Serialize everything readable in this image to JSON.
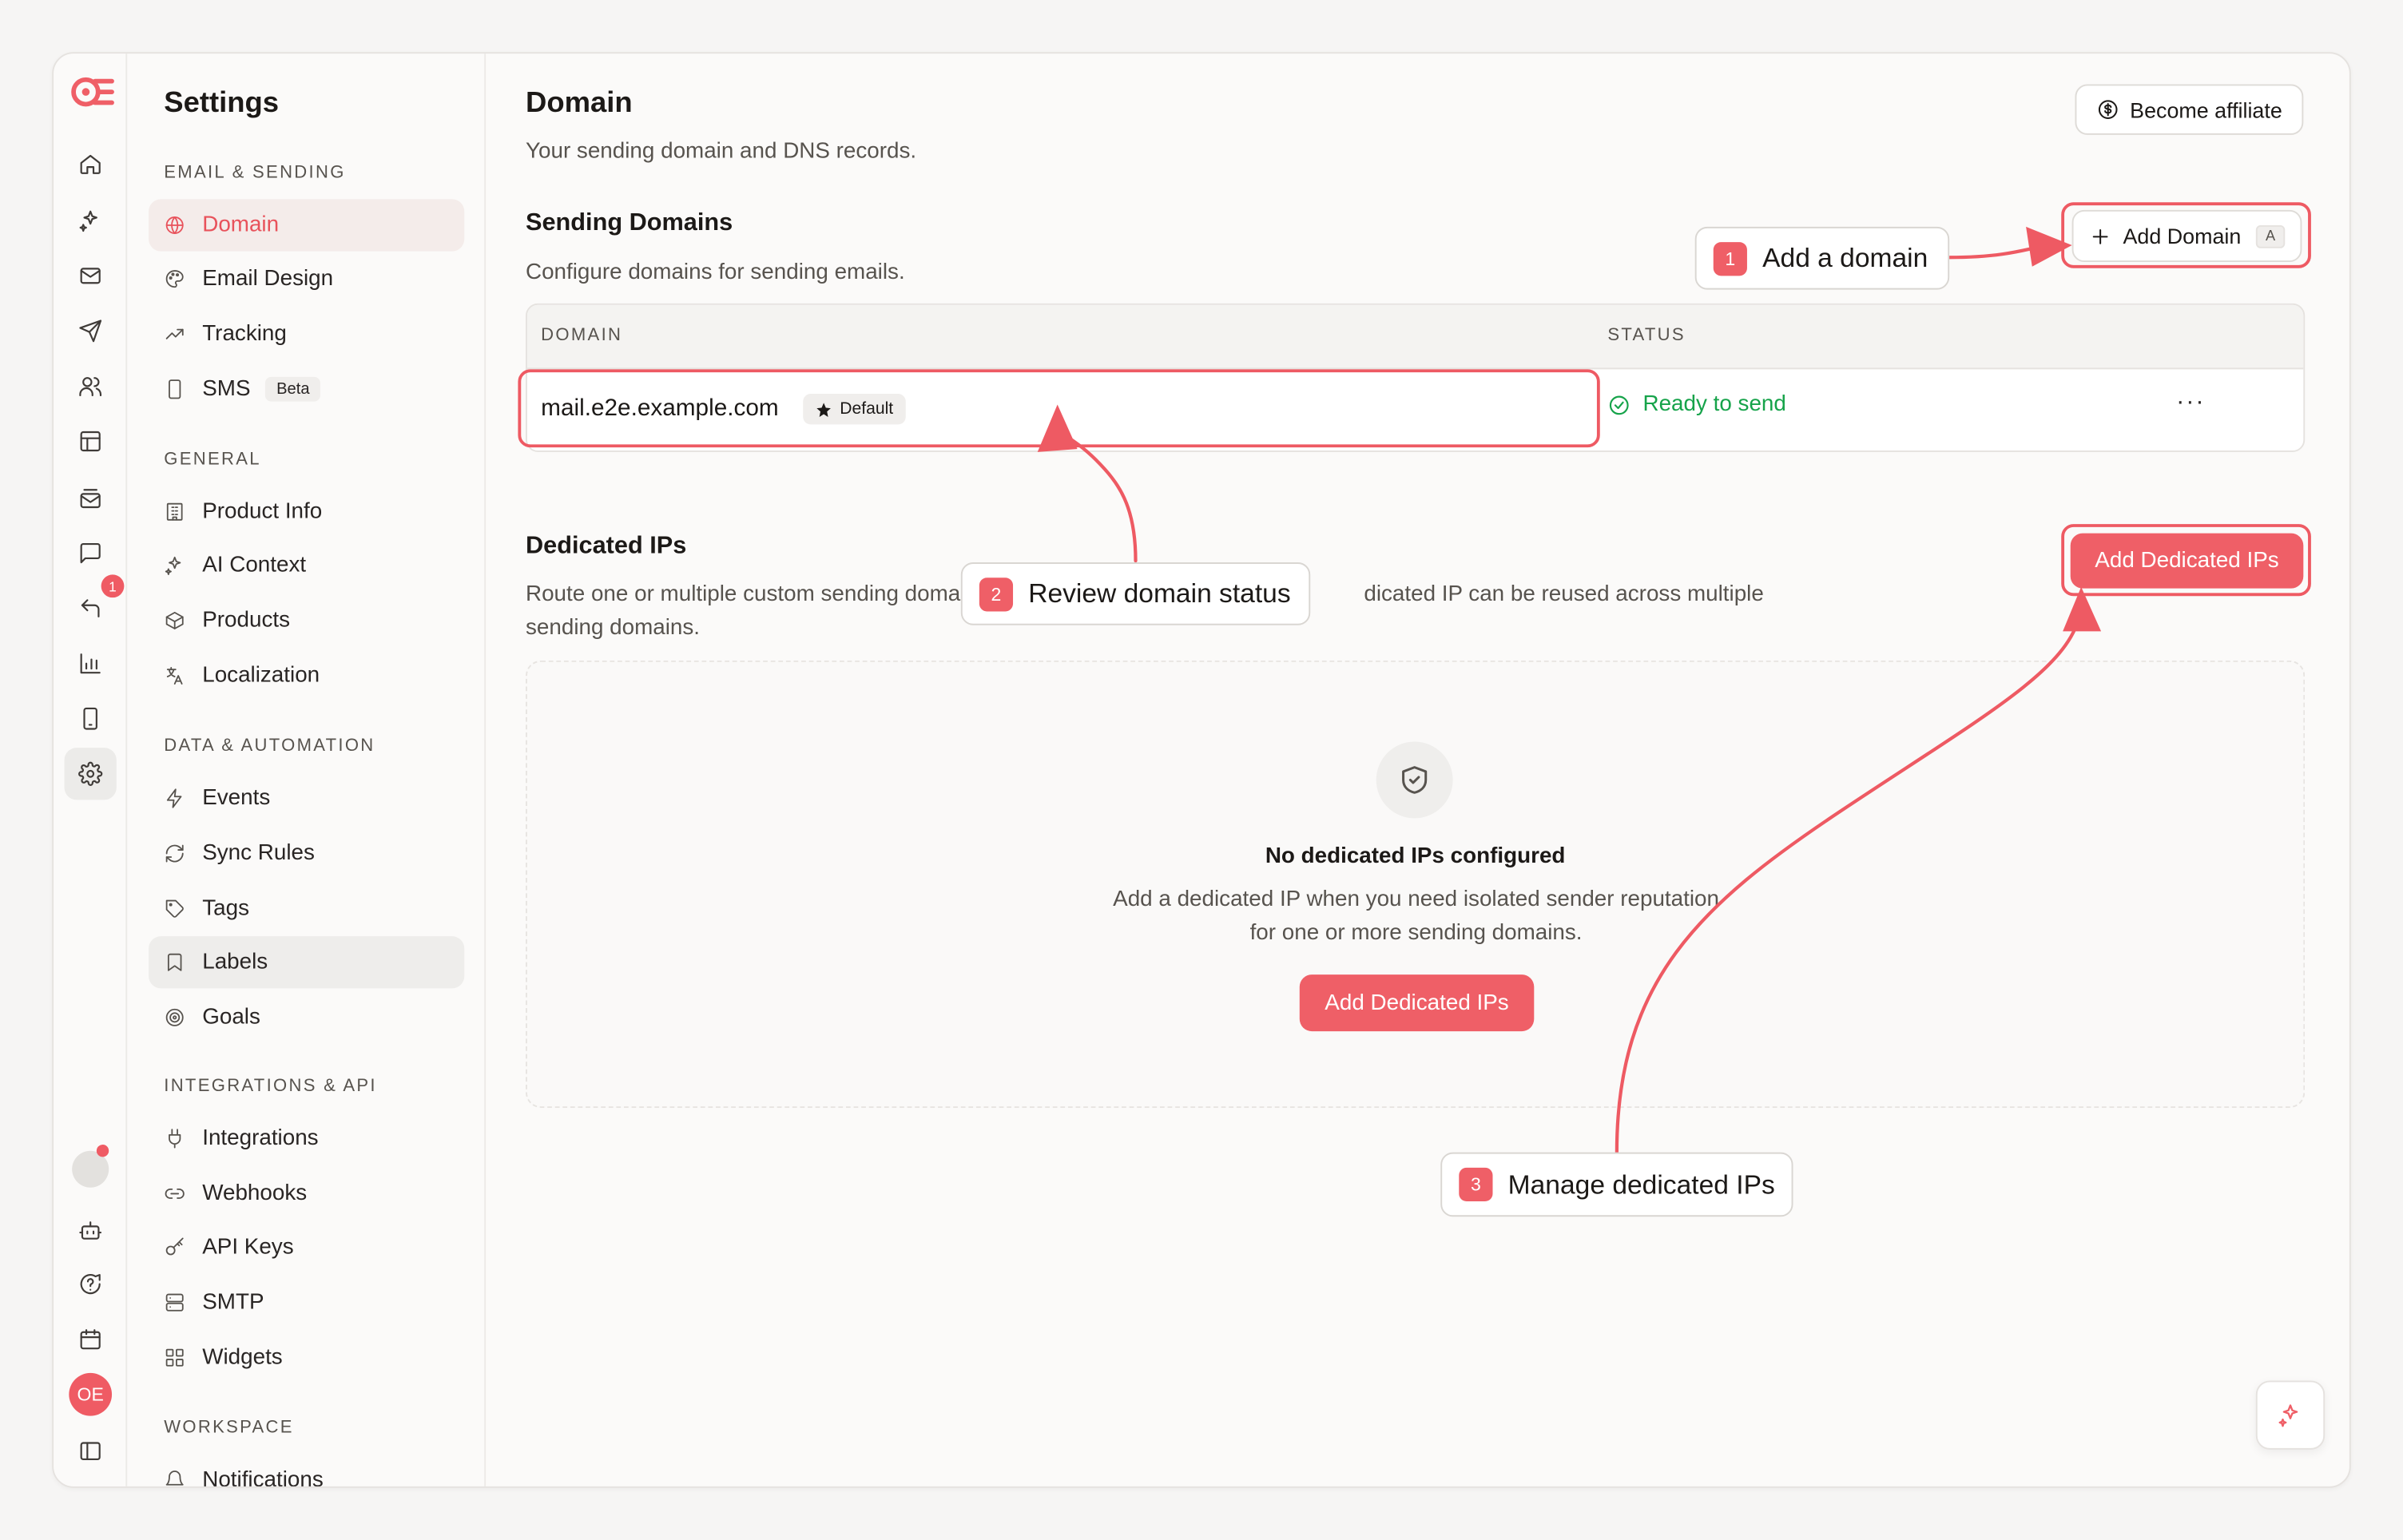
{
  "colors": {
    "accent": "#ef5f67",
    "success": "#16a34a",
    "background": "#fbfaf9"
  },
  "rail": {
    "items": [
      {
        "icon": "home-icon"
      },
      {
        "icon": "sparkles-icon"
      },
      {
        "icon": "mail-icon"
      },
      {
        "icon": "send-icon"
      },
      {
        "icon": "users-icon"
      },
      {
        "icon": "layout-icon"
      },
      {
        "icon": "mail-stack-icon"
      },
      {
        "icon": "message-icon"
      },
      {
        "icon": "reply-icon",
        "badge": "1"
      },
      {
        "icon": "bar-chart-icon"
      },
      {
        "icon": "smartphone-icon"
      },
      {
        "icon": "settings-icon",
        "active": true
      }
    ],
    "bottom": [
      {
        "icon": "bot-icon"
      },
      {
        "icon": "help-icon"
      },
      {
        "icon": "calendar-icon"
      },
      {
        "icon": "sidebar-toggle-icon"
      }
    ],
    "user_initials": "OE"
  },
  "settings_nav": {
    "title": "Settings",
    "sections": [
      {
        "label": "EMAIL & SENDING",
        "items": [
          {
            "label": "Domain",
            "icon": "globe-icon",
            "active": true
          },
          {
            "label": "Email Design",
            "icon": "palette-icon"
          },
          {
            "label": "Tracking",
            "icon": "trending-icon"
          },
          {
            "label": "SMS",
            "icon": "phone-icon",
            "badge": "Beta"
          }
        ]
      },
      {
        "label": "GENERAL",
        "items": [
          {
            "label": "Product Info",
            "icon": "building-icon"
          },
          {
            "label": "AI Context",
            "icon": "sparkles-icon"
          },
          {
            "label": "Products",
            "icon": "package-icon"
          },
          {
            "label": "Localization",
            "icon": "languages-icon"
          }
        ]
      },
      {
        "label": "DATA & AUTOMATION",
        "items": [
          {
            "label": "Events",
            "icon": "zap-icon"
          },
          {
            "label": "Sync Rules",
            "icon": "refresh-icon"
          },
          {
            "label": "Tags",
            "icon": "tag-icon"
          },
          {
            "label": "Labels",
            "icon": "bookmark-icon",
            "hover": true
          },
          {
            "label": "Goals",
            "icon": "target-icon"
          }
        ]
      },
      {
        "label": "INTEGRATIONS & API",
        "items": [
          {
            "label": "Integrations",
            "icon": "plug-icon"
          },
          {
            "label": "Webhooks",
            "icon": "link-icon"
          },
          {
            "label": "API Keys",
            "icon": "key-icon"
          },
          {
            "label": "SMTP",
            "icon": "server-icon"
          },
          {
            "label": "Widgets",
            "icon": "grid-icon"
          }
        ]
      },
      {
        "label": "WORKSPACE",
        "items": [
          {
            "label": "Notifications",
            "icon": "bell-icon"
          }
        ]
      }
    ]
  },
  "main": {
    "title": "Domain",
    "subtitle": "Your sending domain and DNS records.",
    "affiliate_label": "Become affiliate",
    "sending": {
      "title": "Sending Domains",
      "subtitle": "Configure domains for sending emails.",
      "add_label": "Add Domain",
      "add_shortcut": "A",
      "columns": [
        "DOMAIN",
        "STATUS"
      ],
      "rows": [
        {
          "domain": "mail.e2e.example.com",
          "badge": "Default",
          "status": "Ready to send",
          "menu": "···"
        }
      ]
    },
    "dedicated": {
      "title": "Dedicated IPs",
      "subtitle_line1": "Route one or multiple custom sending doma",
      "subtitle_line1b": "dicated IP can be reused across multiple",
      "subtitle_line2": "sending domains.",
      "add_label": "Add Dedicated IPs",
      "empty_title": "No dedicated IPs configured",
      "empty_text": "Add a dedicated IP when you need isolated sender reputation for one or more sending domains.",
      "empty_button": "Add Dedicated IPs"
    }
  },
  "annotations": [
    {
      "num": "1",
      "label": "Add a domain"
    },
    {
      "num": "2",
      "label": "Review domain status"
    },
    {
      "num": "3",
      "label": "Manage dedicated IPs"
    }
  ]
}
